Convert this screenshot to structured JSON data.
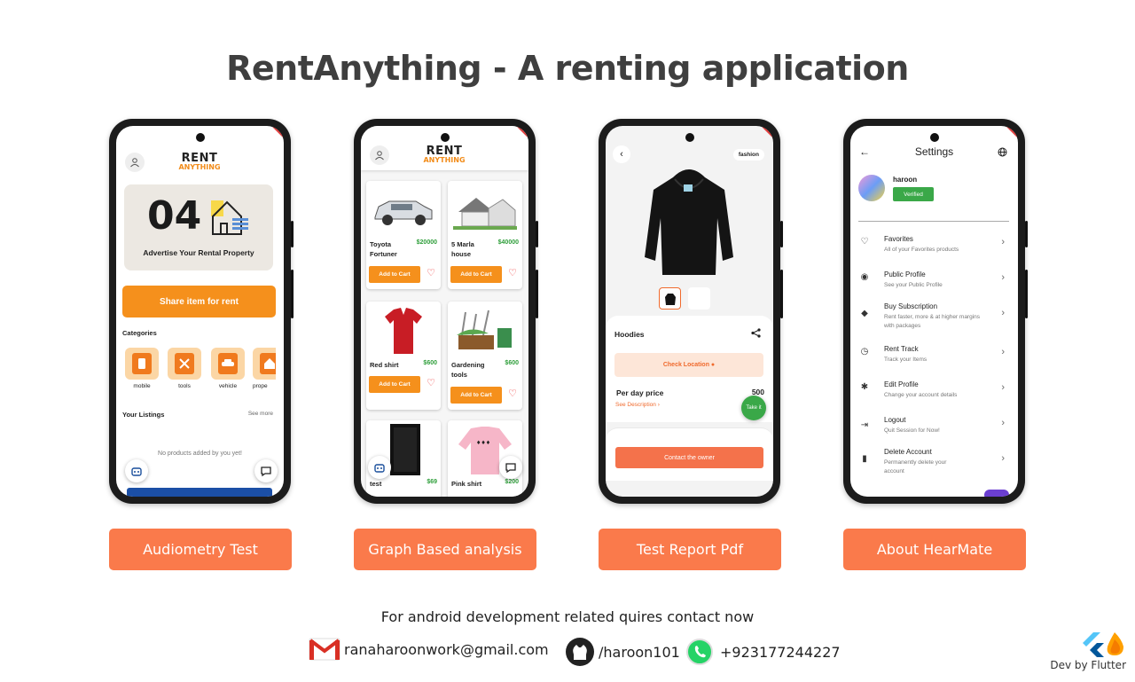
{
  "title": "RentAnything - A renting application",
  "logo": {
    "line1": "RENT",
    "line2": "ANYTHING"
  },
  "screen1": {
    "advert_number": "04",
    "advert_text": "Advertise Your Rental Property",
    "share_button": "Share item for rent",
    "categories_label": "Categories",
    "categories": [
      {
        "label": "mobile",
        "icon": "mobile-icon"
      },
      {
        "label": "tools",
        "icon": "tools-icon"
      },
      {
        "label": "vehicle",
        "icon": "car-icon"
      },
      {
        "label": "prope",
        "icon": "property-icon"
      }
    ],
    "listings_label": "Your Listings",
    "see_more": "See more",
    "empty_message": "No products added by you yet!"
  },
  "screen2": {
    "add_to_cart": "Add to Cart",
    "products": [
      {
        "name": "Toyota Fortuner",
        "price": "$20000"
      },
      {
        "name": "5 Marla house",
        "price": "$40000"
      },
      {
        "name": "Red shirt",
        "price": "$600"
      },
      {
        "name": "Gardening tools",
        "price": "$600"
      },
      {
        "name": "test",
        "price": "$69"
      },
      {
        "name": "Pink shirt",
        "price": "$200"
      }
    ]
  },
  "screen3": {
    "tag": "fashion",
    "product_name": "Hoodies",
    "check_location": "Check Location",
    "per_day_label": "Per day price",
    "per_day_value": "500",
    "see_description": "See Description",
    "take_it": "Take it",
    "contact_owner": "Contact the owner"
  },
  "screen4": {
    "title": "Settings",
    "user_name": "haroon",
    "verified": "Verified",
    "menu": [
      {
        "title": "Favorites",
        "subtitle": "All of your Favorites products",
        "icon": "heart-icon"
      },
      {
        "title": "Public Profile",
        "subtitle": "See your Public Profile",
        "icon": "eye-icon"
      },
      {
        "title": "Buy Subscription",
        "subtitle": "Rent faster, more & at higher margins with packages",
        "icon": "tag-icon"
      },
      {
        "title": "Rent Track",
        "subtitle": "Track your Items",
        "icon": "history-icon"
      },
      {
        "title": "Edit Profile",
        "subtitle": "Change your account details",
        "icon": "gear-icon"
      },
      {
        "title": "Logout",
        "subtitle": "Quit Session for Now!",
        "icon": "logout-icon"
      },
      {
        "title": "Delete Account",
        "subtitle": "Permanently delete your account",
        "icon": "trash-icon"
      }
    ]
  },
  "buttons": [
    "Audiometry Test",
    "Graph Based analysis",
    "Test Report Pdf",
    "About HearMate"
  ],
  "contact": {
    "line": "For android development related quires contact now",
    "email": "ranaharoonwork@gmail.com",
    "github": "/haroon101",
    "whatsapp": "+923177244227"
  },
  "dev_by": "Dev by Flutter",
  "colors": {
    "accent": "#f5901c",
    "button": "#fa7a4b",
    "price_green": "#2e9e3a"
  }
}
